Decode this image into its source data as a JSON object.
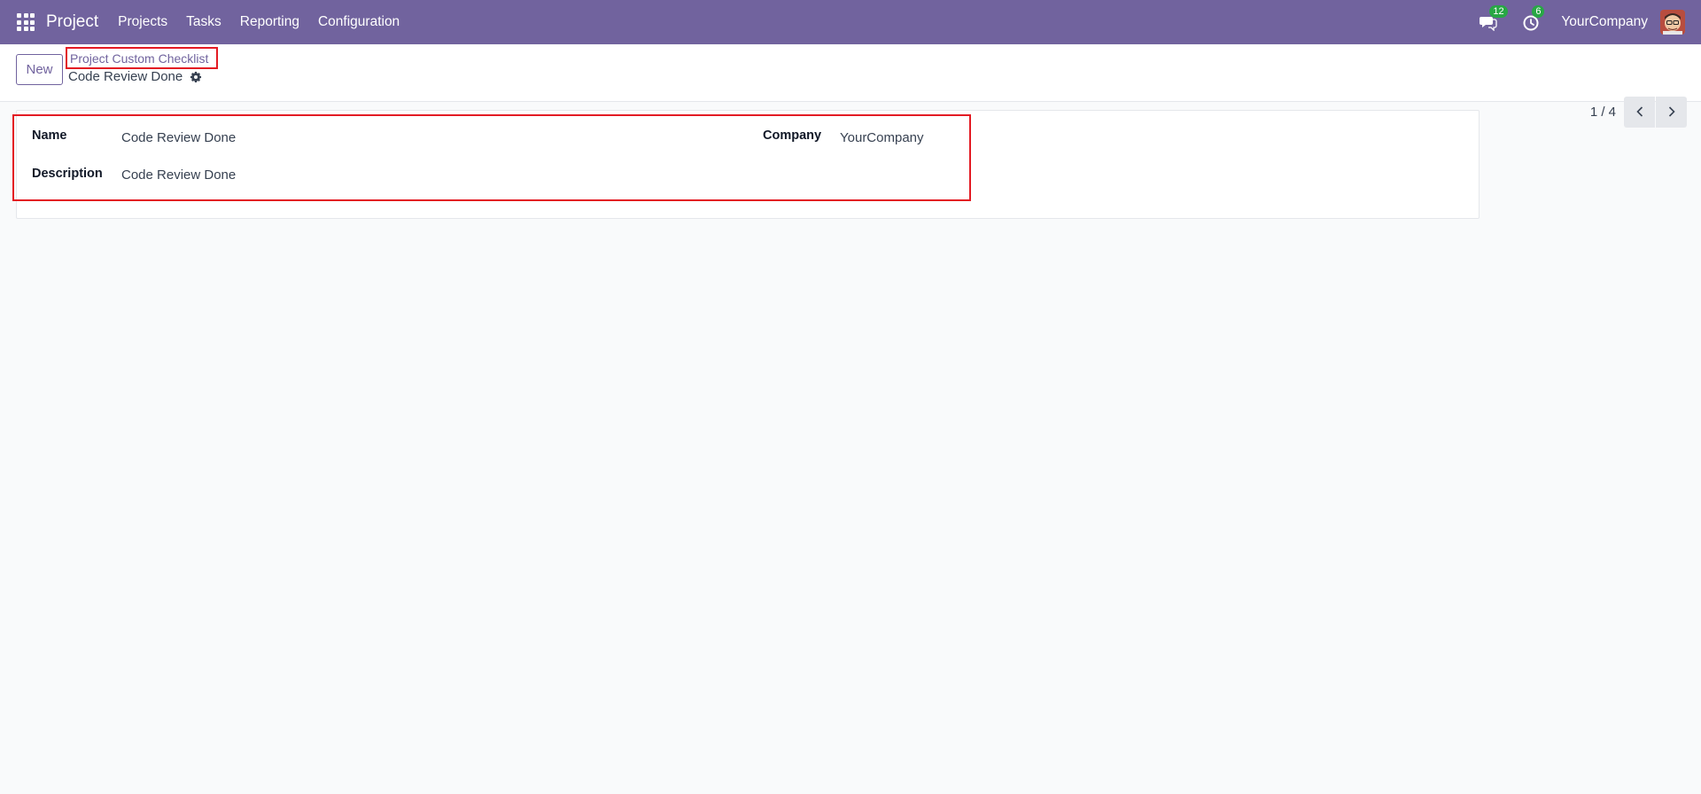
{
  "navbar": {
    "app_name": "Project",
    "menu": [
      "Projects",
      "Tasks",
      "Reporting",
      "Configuration"
    ],
    "messages_count": "12",
    "activities_count": "6",
    "company": "YourCompany",
    "bg_color": "#71639e"
  },
  "control_panel": {
    "new_label": "New",
    "breadcrumb": "Project Custom Checklist",
    "record_title": "Code Review Done",
    "pager": "1 / 4"
  },
  "form": {
    "name_label": "Name",
    "name_value": "Code Review Done",
    "description_label": "Description",
    "description_value": "Code Review Done",
    "company_label": "Company",
    "company_value": "YourCompany"
  },
  "icons": {
    "apps": "apps-grid-icon",
    "messages": "chat-icon",
    "activities": "clock-icon",
    "settings": "gear-icon",
    "prev": "chevron-left-icon",
    "next": "chevron-right-icon"
  },
  "colors": {
    "accent": "#71639e",
    "badge": "#28a745",
    "highlight": "#e31b23"
  }
}
